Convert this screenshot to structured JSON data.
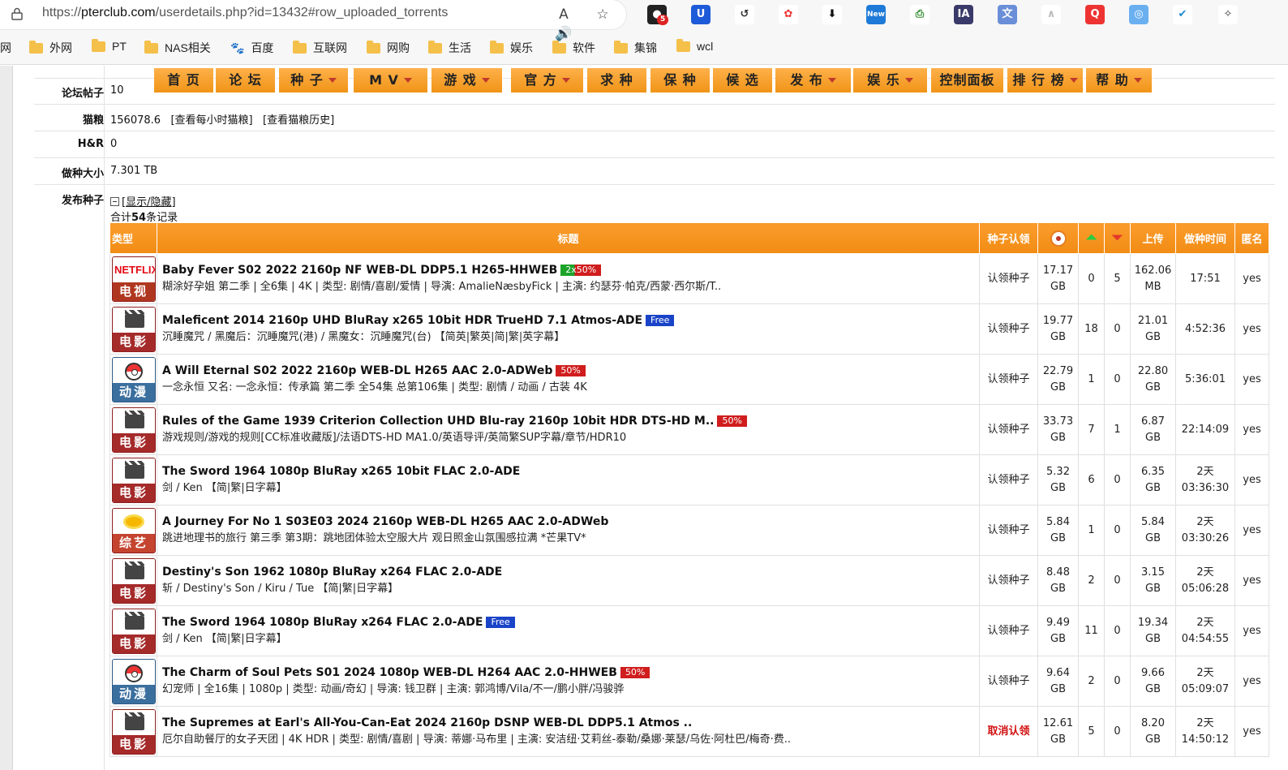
{
  "browser": {
    "url_prefix": "https://",
    "url_host": "pterclub.com",
    "url_path": "/userdetails.php?id=13432#row_uploaded_torrents",
    "read_aloud_icon": "read-aloud-icon",
    "favorite_icon": "star-icon",
    "extension_badge": "5",
    "extension_new_label": "New"
  },
  "bookmarks": [
    {
      "label": "网",
      "folder": false
    },
    {
      "label": "外网",
      "folder": true
    },
    {
      "label": "PT",
      "folder": true
    },
    {
      "label": "NAS相关",
      "folder": true
    },
    {
      "label": "百度",
      "folder": false
    },
    {
      "label": "互联网",
      "folder": true
    },
    {
      "label": "网购",
      "folder": true
    },
    {
      "label": "生活",
      "folder": true
    },
    {
      "label": "娱乐",
      "folder": true
    },
    {
      "label": "软件",
      "folder": true
    },
    {
      "label": "集锦",
      "folder": true
    },
    {
      "label": "wcl",
      "folder": true
    }
  ],
  "nav": [
    {
      "label": "首 页",
      "dropdown": false
    },
    {
      "label": "论 坛",
      "dropdown": false
    },
    {
      "label": "种 子",
      "dropdown": true
    },
    {
      "label": "M V",
      "dropdown": true
    },
    {
      "label": "游 戏",
      "dropdown": true
    },
    {
      "label": "官 方",
      "dropdown": true
    },
    {
      "label": "求 种",
      "dropdown": false
    },
    {
      "label": "保 种",
      "dropdown": false
    },
    {
      "label": "候 选",
      "dropdown": false
    },
    {
      "label": "发 布",
      "dropdown": true
    },
    {
      "label": "娱 乐",
      "dropdown": true
    },
    {
      "label": "控制面板",
      "dropdown": false
    },
    {
      "label": "排 行 榜",
      "dropdown": true
    },
    {
      "label": "帮 助",
      "dropdown": true
    }
  ],
  "profile": {
    "forum_posts_label": "论坛帖子",
    "forum_posts": "10",
    "catfood_label": "猫粮",
    "catfood": "156078.6",
    "catfood_hourly_link": "[查看每小时猫粮]",
    "catfood_history_link": "[查看猫粮历史]",
    "hr_label": "H&R",
    "hr": "0",
    "seeding_size_label": "做种大小",
    "seeding_size": "7.301 TB",
    "uploaded_label": "发布种子",
    "toggle_link": "[显示/隐藏]",
    "total_prefix": "合计",
    "total_count": "54",
    "total_suffix": "条记录"
  },
  "table": {
    "headers": {
      "type": "类型",
      "title": "标题",
      "claim": "种子认领",
      "size_icon": "size-disc-icon",
      "seeders_icon": "seeders-up-icon",
      "leechers_icon": "leechers-down-icon",
      "uploaded": "上传",
      "seed_time": "做种时间",
      "anonymous": "匿名"
    },
    "rows": [
      {
        "cat": "电视剧",
        "cat_style": "netflix",
        "title": "Baby Fever S02 2022 2160p NF WEB-DL DDP5.1 H265-HHWEB",
        "tag": "2x50%",
        "tag_style": "twohalf",
        "sub": "糊涂好孕姐 第二季 | 全6集 | 4K | 类型: 剧情/喜剧/爱情 | 导演: AmalieNæsbyFick | 主演: 约瑟芬·帕克/西蒙·西尔斯/T..",
        "claim": "认领种子",
        "claim_cancel": false,
        "size1": "17.17",
        "size2": "GB",
        "seeders": "0",
        "leechers": "5",
        "up1": "162.06",
        "up2": "MB",
        "time1": "17:51",
        "time2": "",
        "anon": "yes"
      },
      {
        "cat": "电影",
        "cat_style": "movie",
        "title": "Maleficent 2014 2160p UHD BluRay x265 10bit HDR TrueHD 7.1 Atmos-ADE",
        "tag": "Free",
        "tag_style": "free",
        "sub": "沉睡魔咒 / 黑魔后：沉睡魔咒(港) / 黑魔女：沉睡魔咒(台) 【简英|繁英|简|繁|英字幕】",
        "claim": "认领种子",
        "claim_cancel": false,
        "size1": "19.77",
        "size2": "GB",
        "seeders": "18",
        "leechers": "0",
        "up1": "21.01",
        "up2": "GB",
        "time1": "4:52:36",
        "time2": "",
        "anon": "yes"
      },
      {
        "cat": "动漫",
        "cat_style": "anime",
        "title": "A Will Eternal S02 2022 2160p WEB-DL H265 AAC 2.0-ADWeb",
        "tag": "50%",
        "tag_style": "half",
        "sub": "一念永恒 又名: 一念永恒：传承篇 第二季 全54集 总第106集 | 类型: 剧情 / 动画 / 古装 4K",
        "claim": "认领种子",
        "claim_cancel": false,
        "size1": "22.79",
        "size2": "GB",
        "seeders": "1",
        "leechers": "0",
        "up1": "22.80",
        "up2": "GB",
        "time1": "5:36:01",
        "time2": "",
        "anon": "yes"
      },
      {
        "cat": "电影",
        "cat_style": "movie",
        "title": "Rules of the Game 1939 Criterion Collection UHD Blu-ray 2160p 10bit HDR DTS-HD M..",
        "tag": "50%",
        "tag_style": "half",
        "sub": "游戏规则/游戏的规则[CC标准收藏版]/法语DTS-HD MA1.0/英语导评/英简繁SUP字幕/章节/HDR10",
        "claim": "认领种子",
        "claim_cancel": false,
        "size1": "33.73",
        "size2": "GB",
        "seeders": "7",
        "leechers": "1",
        "up1": "6.87",
        "up2": "GB",
        "time1": "22:14:09",
        "time2": "",
        "anon": "yes"
      },
      {
        "cat": "电影",
        "cat_style": "movie",
        "title": "The Sword 1964 1080p BluRay x265 10bit FLAC 2.0-ADE",
        "tag": "",
        "tag_style": "",
        "sub": "剑 / Ken 【简|繁|日字幕】",
        "claim": "认领种子",
        "claim_cancel": false,
        "size1": "5.32",
        "size2": "GB",
        "seeders": "6",
        "leechers": "0",
        "up1": "6.35",
        "up2": "GB",
        "time1": "2天",
        "time2": "03:36:30",
        "anon": "yes"
      },
      {
        "cat": "综艺",
        "cat_style": "variety",
        "title": "A Journey For No 1 S03E03 2024 2160p WEB-DL H265 AAC 2.0-ADWeb",
        "tag": "",
        "tag_style": "",
        "sub": "跳进地理书的旅行 第三季 第3期：跳地团体验太空服大片 观日照金山氛围感拉满 *芒果TV*",
        "claim": "认领种子",
        "claim_cancel": false,
        "size1": "5.84",
        "size2": "GB",
        "seeders": "1",
        "leechers": "0",
        "up1": "5.84",
        "up2": "GB",
        "time1": "2天",
        "time2": "03:30:26",
        "anon": "yes"
      },
      {
        "cat": "电影",
        "cat_style": "movie",
        "title": "Destiny's Son 1962 1080p BluRay x264 FLAC 2.0-ADE",
        "tag": "",
        "tag_style": "",
        "sub": "斩 / Destiny's Son / Kiru / Tue 【简|繁|日字幕】",
        "claim": "认领种子",
        "claim_cancel": false,
        "size1": "8.48",
        "size2": "GB",
        "seeders": "2",
        "leechers": "0",
        "up1": "3.15",
        "up2": "GB",
        "time1": "2天",
        "time2": "05:06:28",
        "anon": "yes"
      },
      {
        "cat": "电影",
        "cat_style": "movie",
        "title": "The Sword 1964 1080p BluRay x264 FLAC 2.0-ADE",
        "tag": "Free",
        "tag_style": "free",
        "sub": "剑 / Ken 【简|繁|日字幕】",
        "claim": "认领种子",
        "claim_cancel": false,
        "size1": "9.49",
        "size2": "GB",
        "seeders": "11",
        "leechers": "0",
        "up1": "19.34",
        "up2": "GB",
        "time1": "2天",
        "time2": "04:54:55",
        "anon": "yes"
      },
      {
        "cat": "动漫",
        "cat_style": "anime",
        "title": "The Charm of Soul Pets S01 2024 1080p WEB-DL H264 AAC 2.0-HHWEB",
        "tag": "50%",
        "tag_style": "half",
        "sub": "幻宠师 | 全16集 | 1080p | 类型: 动画/奇幻 | 导演: 钱卫群 | 主演: 郭鸿博/Vila/不一/鹏小胖/冯骏骅",
        "claim": "认领种子",
        "claim_cancel": false,
        "size1": "9.64",
        "size2": "GB",
        "seeders": "2",
        "leechers": "0",
        "up1": "9.66",
        "up2": "GB",
        "time1": "2天",
        "time2": "05:09:07",
        "anon": "yes"
      },
      {
        "cat": "电影",
        "cat_style": "movie",
        "title": "The Supremes at Earl's All-You-Can-Eat 2024 2160p DSNP WEB-DL DDP5.1 Atmos ..",
        "tag": "",
        "tag_style": "",
        "sub": "厄尔自助餐厅的女子天团 | 4K HDR | 类型: 剧情/喜剧 | 导演: 蒂娜·马布里 | 主演: 安洁纽·艾莉丝-泰勒/桑娜·莱瑟/乌佐·阿杜巴/梅奇·费..",
        "claim": "取消认领",
        "claim_cancel": true,
        "size1": "12.61",
        "size2": "GB",
        "seeders": "5",
        "leechers": "0",
        "up1": "8.20",
        "up2": "GB",
        "time1": "2天",
        "time2": "14:50:12",
        "anon": "yes"
      }
    ]
  }
}
